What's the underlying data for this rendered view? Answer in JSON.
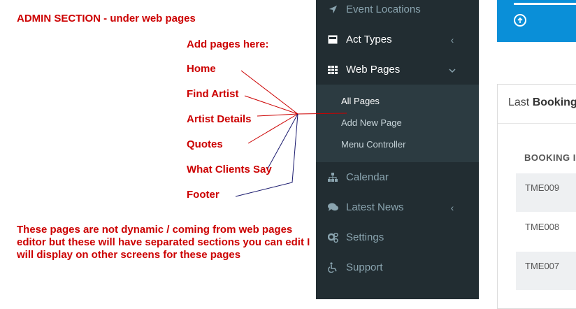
{
  "annotation": {
    "title": "ADMIN SECTION - under web pages",
    "heading": "Add pages here:",
    "items": [
      "Home",
      "Find Artist",
      "Artist Details",
      "Quotes",
      "What Clients Say",
      "Footer"
    ],
    "note": "These pages are not dynamic / coming from web pages editor but these will have separated sections you can edit I will display on other screens for these pages",
    "color": "#cc0000"
  },
  "sidebar": {
    "items": [
      {
        "label": "Event Locations",
        "icon": "location-arrow-icon"
      },
      {
        "label": "Act Types",
        "icon": "inbox-icon"
      },
      {
        "label": "Web Pages",
        "icon": "grid-icon"
      },
      {
        "label": "Calendar",
        "icon": "sitemap-icon"
      },
      {
        "label": "Latest News",
        "icon": "comments-icon"
      },
      {
        "label": "Settings",
        "icon": "gears-icon"
      },
      {
        "label": "Support",
        "icon": "wheelchair-icon"
      }
    ],
    "submenu": [
      "All Pages",
      "Add New Page",
      "Menu Controller"
    ],
    "bg": "#222d32"
  },
  "main": {
    "panel_title_prefix": "Last",
    "panel_title_bold": "Booking",
    "column_header": "BOOKING I",
    "rows": [
      "TME009",
      "TME008",
      "TME007"
    ],
    "accent": "#0a8fd8"
  }
}
